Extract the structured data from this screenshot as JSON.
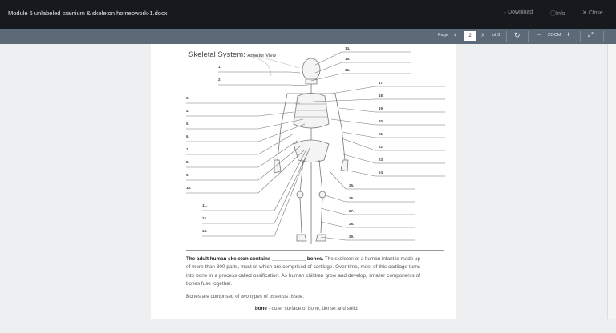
{
  "header": {
    "title": "Module 6 unlabeled crainium & skeleton homeowork-1.docx",
    "download": "Download",
    "info": "Info",
    "close": "Close"
  },
  "toolbar": {
    "page_label": "Page",
    "page": "2",
    "of": "of 3",
    "zoom_label": "ZOOM"
  },
  "doc": {
    "heading": "Skeletal System:",
    "subheading": "Anterior View",
    "left_labels": [
      "1.",
      "2.",
      "3.",
      "4.",
      "5.",
      "6.",
      "7.",
      "8.",
      "9.",
      "10.",
      "11.",
      "12.",
      "13."
    ],
    "right_labels": [
      "14.",
      "15.",
      "16.",
      "17.",
      "18.",
      "19.",
      "20.",
      "21.",
      "22.",
      "23.",
      "24.",
      "25.",
      "26.",
      "27.",
      "28.",
      "29."
    ],
    "para_bold": "The adult human skeleton contains ____________ bones.",
    "para_rest": " The skeleton of a human infant is made up of more than 300 parts, most of which are comprised of cartilage. Over time, most of this cartilage turns into bone in a process called ossification. As human children grow and develop, smaller components of bones fuse together.",
    "tissue": "Bones are comprised of two types of osseous tissue:",
    "blank": "________________________",
    "compact_bold": "bone",
    "compact_rest": " - outer surface of bone, dense and solid"
  }
}
